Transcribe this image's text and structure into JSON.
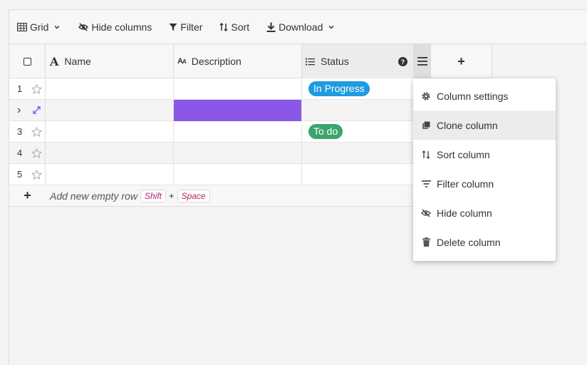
{
  "toolbar": {
    "view_label": "Grid",
    "hide_columns_label": "Hide columns",
    "filter_label": "Filter",
    "sort_label": "Sort",
    "download_label": "Download"
  },
  "columns": {
    "name": "Name",
    "description": "Description",
    "status": "Status",
    "add": "+"
  },
  "rows": [
    {
      "num": "1",
      "status": "In Progress",
      "status_color": "#1f9be0"
    },
    {
      "num": "",
      "expand": "›",
      "status": "",
      "highlight_color": "#8b57e6"
    },
    {
      "num": "3",
      "status": "To do",
      "status_color": "#3aa56d"
    },
    {
      "num": "4",
      "status": ""
    },
    {
      "num": "5",
      "status": ""
    }
  ],
  "add_row": {
    "plus": "+",
    "label": "Add new empty row",
    "key1": "Shift",
    "joiner": "+",
    "key2": "Space"
  },
  "context_menu": {
    "items": [
      {
        "label": "Column settings",
        "icon": "gear-icon"
      },
      {
        "label": "Clone column",
        "icon": "clone-icon",
        "active": true
      },
      {
        "label": "Sort column",
        "icon": "sort-icon"
      },
      {
        "label": "Filter column",
        "icon": "filter-icon"
      },
      {
        "label": "Hide column",
        "icon": "eye-off-icon"
      },
      {
        "label": "Delete column",
        "icon": "trash-icon"
      }
    ]
  }
}
